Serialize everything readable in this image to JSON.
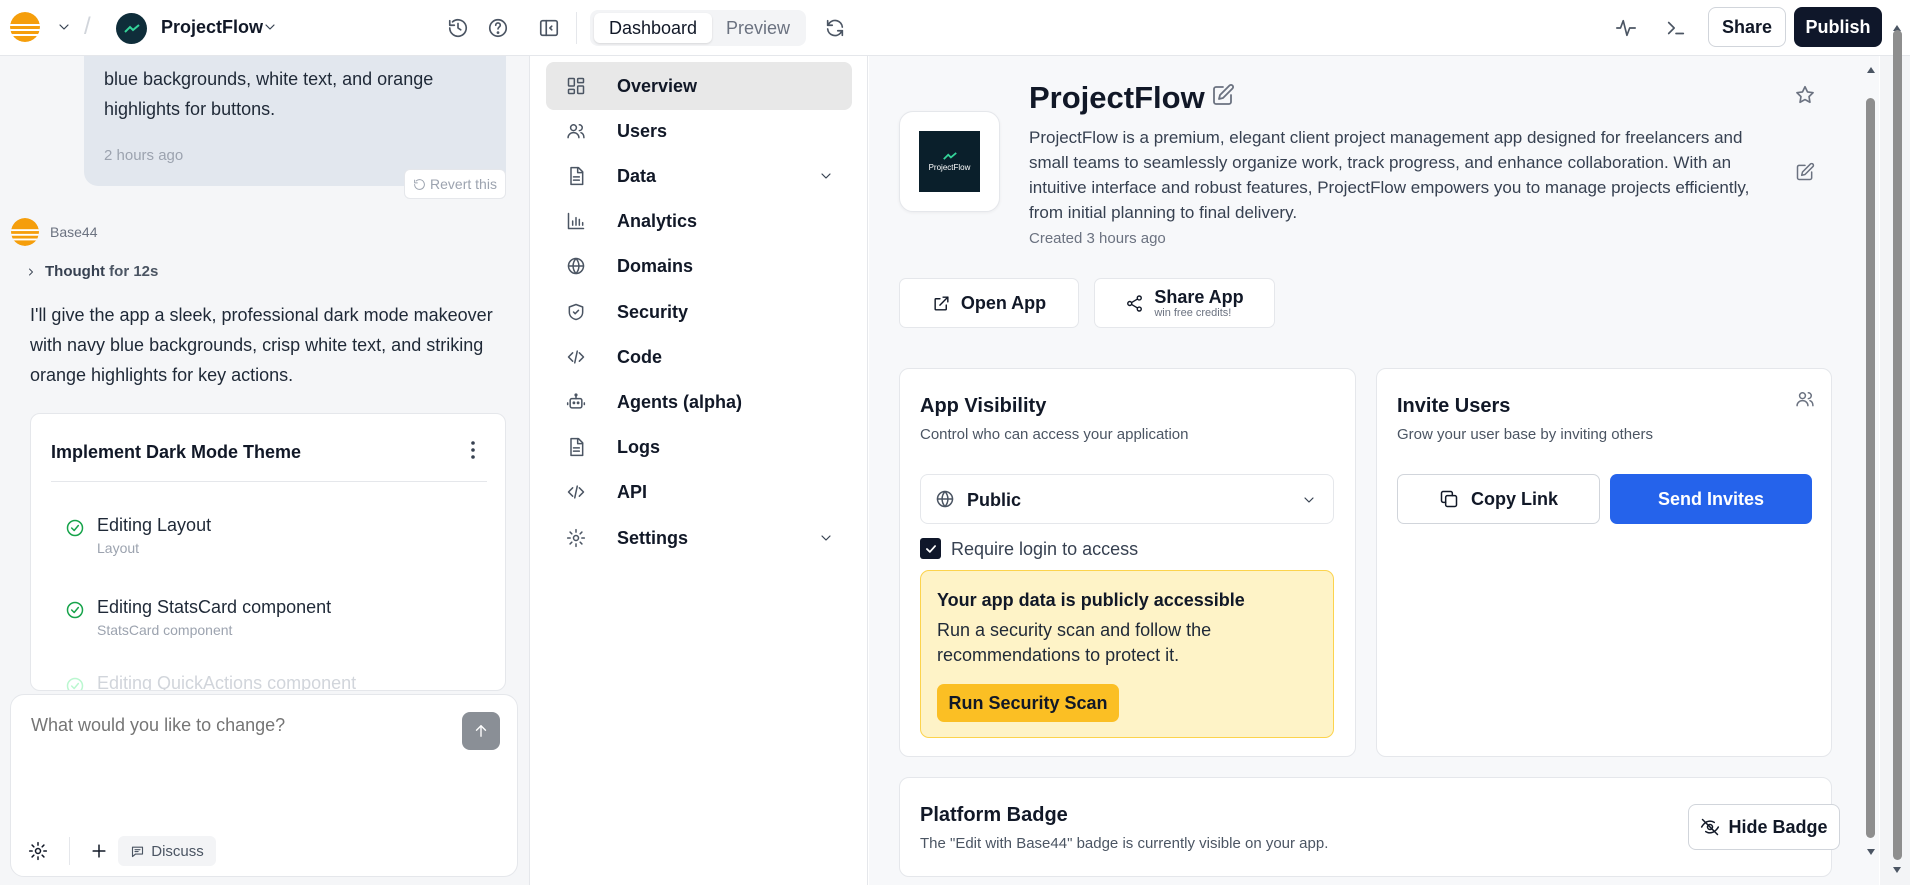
{
  "colors": {
    "accent_orange": "#f59e0b",
    "publish_bg": "#0f172a",
    "send_invites_bg": "#2563eb",
    "warning_bg": "#fef3c7",
    "scan_button": "#fbbf24"
  },
  "header": {
    "project_name": "ProjectFlow",
    "tabs": [
      {
        "label": "Dashboard",
        "active": true
      },
      {
        "label": "Preview",
        "active": false
      }
    ],
    "share_label": "Share",
    "publish_label": "Publish",
    "icons": [
      "history-icon",
      "help-icon",
      "sidebar-toggle-icon",
      "refresh-icon",
      "activity-icon",
      "terminal-icon"
    ]
  },
  "chat": {
    "user_message": "blue backgrounds, white text, and orange highlights for buttons.",
    "user_message_time": "2 hours ago",
    "revert_label": "Revert this",
    "assistant_name": "Base44",
    "thought_label": "Thought",
    "thought_duration": "for 12s",
    "assistant_reply": "I'll give the app a sleek, professional dark mode makeover with navy blue backgrounds, crisp white text, and striking orange highlights for key actions.",
    "task": {
      "title": "Implement Dark Mode Theme",
      "items": [
        {
          "title": "Editing Layout",
          "subtitle": "Layout"
        },
        {
          "title": "Editing StatsCard component",
          "subtitle": "StatsCard component"
        },
        {
          "title": "Editing QuickActions component",
          "subtitle": ""
        }
      ]
    },
    "composer": {
      "placeholder": "What would you like to change?",
      "discuss_label": "Discuss"
    }
  },
  "nav": {
    "items": [
      {
        "label": "Overview",
        "icon": "grid-icon",
        "active": true
      },
      {
        "label": "Users",
        "icon": "users-icon"
      },
      {
        "label": "Data",
        "icon": "file-icon",
        "expandable": true
      },
      {
        "label": "Analytics",
        "icon": "chart-icon"
      },
      {
        "label": "Domains",
        "icon": "globe-icon"
      },
      {
        "label": "Security",
        "icon": "shield-icon"
      },
      {
        "label": "Code",
        "icon": "code-icon"
      },
      {
        "label": "Agents (alpha)",
        "icon": "bot-icon"
      },
      {
        "label": "Logs",
        "icon": "file-icon"
      },
      {
        "label": "API",
        "icon": "code-icon"
      },
      {
        "label": "Settings",
        "icon": "gear-icon",
        "expandable": true
      }
    ]
  },
  "main": {
    "app_icon_label": "ProjectFlow",
    "title": "ProjectFlow",
    "description": "ProjectFlow is a premium, elegant client project management app designed for freelancers and small teams to seamlessly organize work, track progress, and enhance collaboration. With an intuitive interface and robust features, ProjectFlow empowers you to manage projects efficiently, from initial planning to final delivery.",
    "created": "Created 3 hours ago",
    "open_app_label": "Open App",
    "share_app_label": "Share App",
    "share_app_sub": "win free credits!",
    "visibility": {
      "title": "App Visibility",
      "subtitle": "Control who can access your application",
      "selected": "Public",
      "require_login_label": "Require login to access",
      "require_login_checked": true,
      "warning_title": "Your app data is publicly accessible",
      "warning_text": "Run a security scan and follow the recommendations to protect it.",
      "scan_label": "Run Security Scan"
    },
    "invite": {
      "title": "Invite Users",
      "subtitle": "Grow your user base by inviting others",
      "copy_label": "Copy Link",
      "send_label": "Send Invites"
    },
    "badge": {
      "title": "Platform Badge",
      "subtitle": "The \"Edit with Base44\" badge is currently visible on your app.",
      "hide_label": "Hide Badge"
    }
  }
}
